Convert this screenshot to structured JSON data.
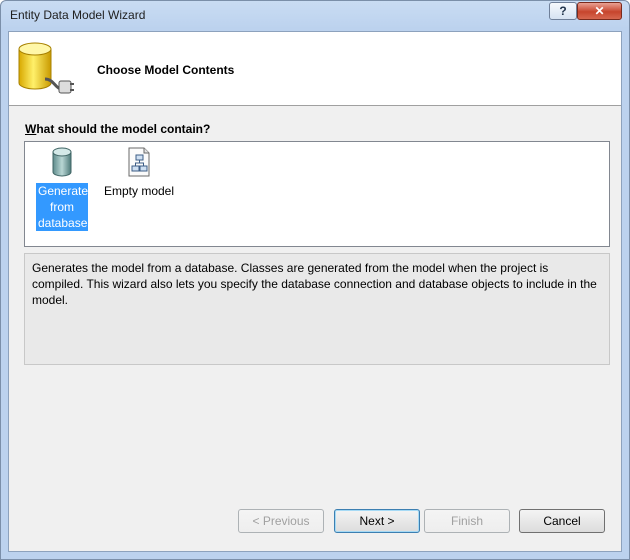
{
  "window": {
    "title": "Entity Data Model Wizard",
    "help_label": "?",
    "close_label": "✕"
  },
  "header": {
    "title": "Choose Model Contents"
  },
  "question": {
    "mnemonic": "W",
    "rest": "hat should the model contain?"
  },
  "model_options": [
    {
      "label": "Generate from database",
      "selected": true,
      "icon": "database-icon"
    },
    {
      "label": "Empty model",
      "selected": false,
      "icon": "empty-model-icon"
    }
  ],
  "description": "Generates the model from a database. Classes are generated from the model when the project is compiled. This wizard also lets you specify the database connection and database objects to include in the model.",
  "buttons": {
    "previous": "< Previous",
    "next": "Next >",
    "finish": "Finish",
    "cancel": "Cancel"
  },
  "colors": {
    "selection": "#3399ff",
    "title_bar": "#bcd2ee"
  }
}
